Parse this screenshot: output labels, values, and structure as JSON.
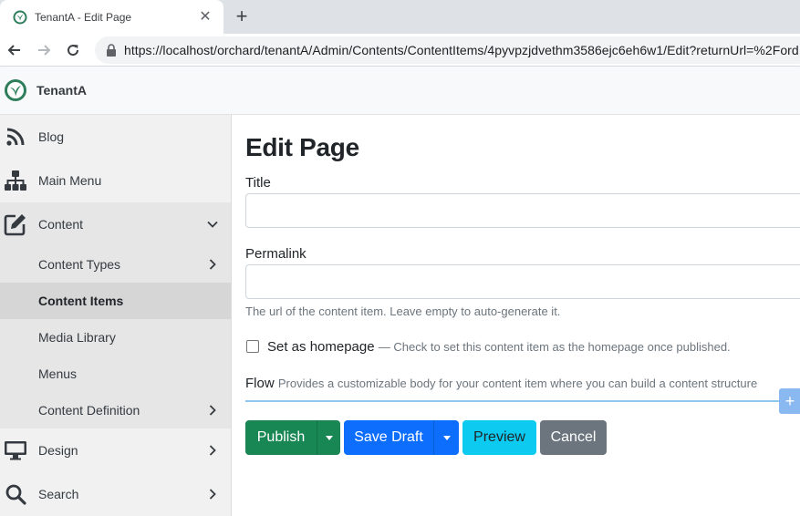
{
  "browser": {
    "tab_title": "TenantA - Edit Page",
    "tab_close": "✕",
    "new_tab": "+",
    "url": "https://localhost/orchard/tenantA/Admin/Contents/ContentItems/4pyvpzjdvethm3586ejc6eh6w1/Edit?returnUrl=%2Ford"
  },
  "header": {
    "brand": "TenantA"
  },
  "sidebar": {
    "items": [
      {
        "label": "Blog",
        "icon": "rss-icon"
      },
      {
        "label": "Main Menu",
        "icon": "sitemap-icon"
      },
      {
        "label": "Content",
        "icon": "edit-icon"
      }
    ],
    "content_children": [
      {
        "label": "Content Types"
      },
      {
        "label": "Content Items"
      },
      {
        "label": "Media Library"
      },
      {
        "label": "Menus"
      },
      {
        "label": "Content Definition"
      }
    ],
    "bottom_items": [
      {
        "label": "Design",
        "icon": "monitor-icon"
      },
      {
        "label": "Search",
        "icon": "search-icon"
      }
    ]
  },
  "main": {
    "title": "Edit Page",
    "title_label": "Title",
    "title_value": "",
    "permalink_label": "Permalink",
    "permalink_value": "",
    "permalink_hint": "The url of the content item. Leave empty to auto-generate it.",
    "homepage_label": "Set as homepage",
    "homepage_hint": "— Check to set this content item as the homepage once published.",
    "flow_label": "Flow",
    "flow_hint": "Provides a customizable body for your content item where you can build a content structure",
    "flow_add": "+",
    "buttons": {
      "publish": "Publish",
      "save_draft": "Save Draft",
      "preview": "Preview",
      "cancel": "Cancel"
    }
  },
  "colors": {
    "publish": "#198754",
    "save_draft": "#0d6efd",
    "preview": "#0dcaf0",
    "cancel": "#6c757d"
  }
}
